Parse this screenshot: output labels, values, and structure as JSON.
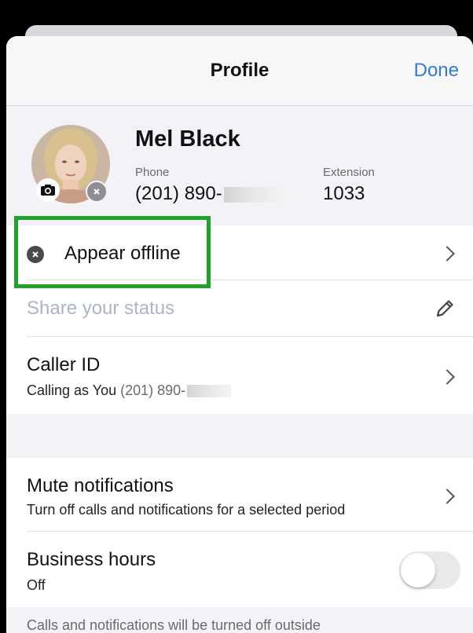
{
  "nav": {
    "title": "Profile",
    "done_label": "Done"
  },
  "profile": {
    "name": "Mel Black",
    "phone_label": "Phone",
    "phone_value": "(201) 890-",
    "extension_label": "Extension",
    "extension_value": "1033"
  },
  "presence": {
    "label": "Appear offline"
  },
  "status": {
    "placeholder": "Share your status"
  },
  "caller_id": {
    "title": "Caller ID",
    "sub_prefix": "Calling as You",
    "sub_number": "(201) 890-"
  },
  "mute": {
    "title": "Mute notifications",
    "subtitle": "Turn off calls and notifications for a selected period"
  },
  "business_hours": {
    "title": "Business hours",
    "value": "Off",
    "enabled": false
  },
  "footer": {
    "text": "Calls and notifications will be turned off outside"
  },
  "colors": {
    "accent": "#2f7bd8",
    "highlight": "#1fa32a",
    "status_placeholder": "#a9b6c6"
  },
  "icons": [
    "camera-icon",
    "offline-status-icon",
    "pencil-icon",
    "chevron-right-icon"
  ]
}
